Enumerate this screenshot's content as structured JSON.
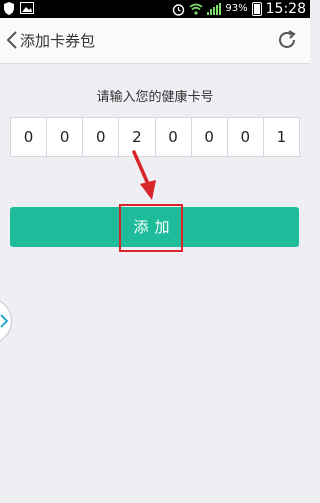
{
  "status_bar": {
    "battery_percent": "93%",
    "time": "15:28",
    "icons": [
      "shield-icon",
      "image-icon",
      "alarm-icon",
      "wifi-icon",
      "signal-icon",
      "battery-icon"
    ]
  },
  "header": {
    "title": "添加卡券包",
    "icons": [
      "back-chevron-icon",
      "refresh-icon"
    ]
  },
  "main": {
    "prompt": "请输入您的健康卡号",
    "digits": [
      "0",
      "0",
      "0",
      "2",
      "0",
      "0",
      "0",
      "1"
    ],
    "add_button_label": "添加",
    "annotation_color": "#d9262b",
    "accent_color": "#1fbc9b"
  }
}
